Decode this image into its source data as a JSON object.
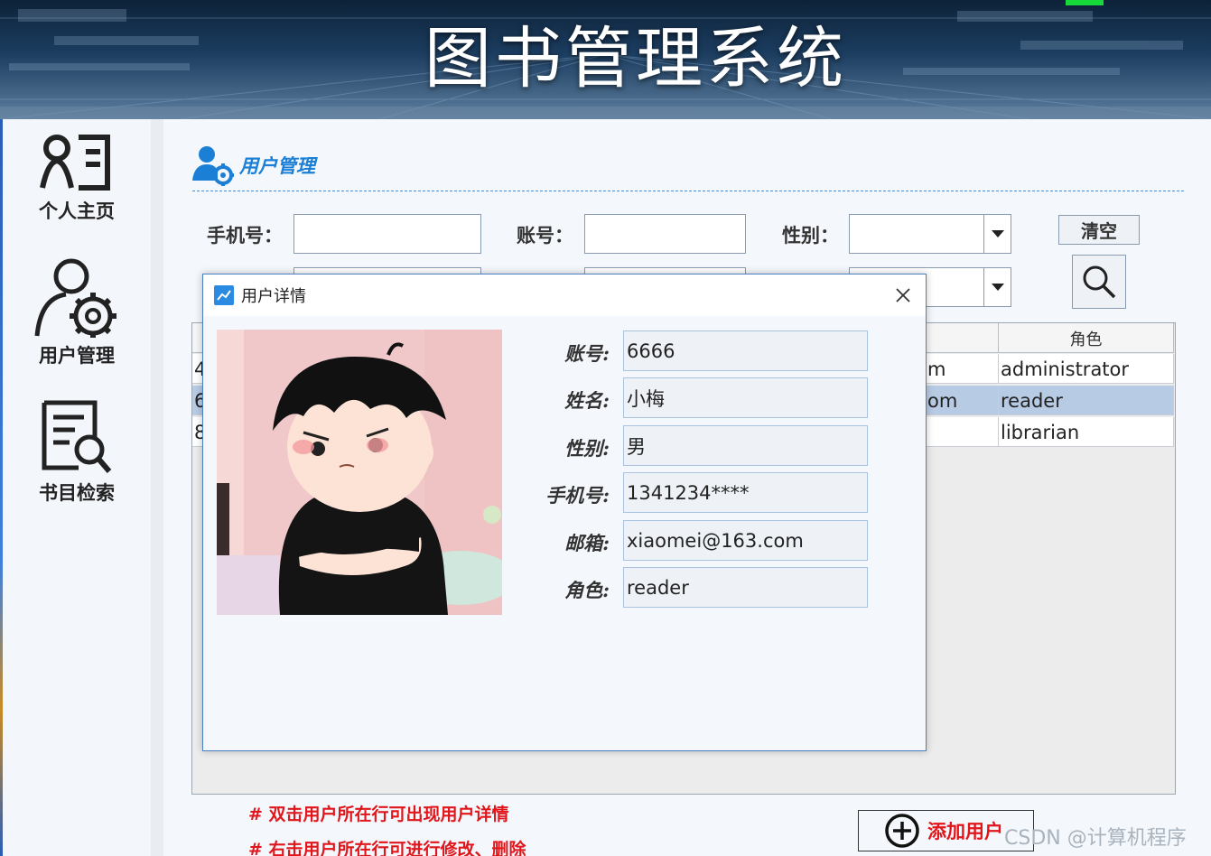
{
  "app": {
    "title": "图书管理系统"
  },
  "sidebar": {
    "items": [
      {
        "label": "个人主页",
        "icon": "profile-card-icon"
      },
      {
        "label": "用户管理",
        "icon": "user-gear-icon"
      },
      {
        "label": "书目检索",
        "icon": "book-search-icon"
      }
    ]
  },
  "page": {
    "section_title": "用户管理",
    "filters": {
      "phone_label": "手机号：",
      "account_label": "账号：",
      "gender_label": "性别：",
      "phone_value": "",
      "account_value": "",
      "gender_value": ""
    },
    "clear_button": "清空",
    "search_icon": "search-icon"
  },
  "table": {
    "role_header": "角色",
    "rows": [
      {
        "id_fragment": "4",
        "email_fragment": "m",
        "role": "administrator",
        "selected": false
      },
      {
        "id_fragment": "6",
        "email_fragment": "om",
        "role": "reader",
        "selected": true
      },
      {
        "id_fragment": "8",
        "email_fragment": "",
        "role": "librarian",
        "selected": false
      }
    ]
  },
  "hints": [
    "# 双击用户所在行可出现用户详情",
    "# 右击用户所在行可进行修改、删除"
  ],
  "add_user_button": "添加用户",
  "dialog": {
    "title": "用户详情",
    "fields": [
      {
        "label": "账号:",
        "value": "6666"
      },
      {
        "label": "姓名:",
        "value": "小梅"
      },
      {
        "label": "性别:",
        "value": "男"
      },
      {
        "label": "手机号:",
        "value": "1341234****"
      },
      {
        "label": "邮箱:",
        "value": "xiaomei@163.com"
      },
      {
        "label": "角色:",
        "value": "reader"
      }
    ]
  },
  "watermark": "CSDN @计算机程序",
  "colors": {
    "accent_blue": "#1b7fd6",
    "hint_red": "#e0161b",
    "selected_row": "#b8cbe4"
  }
}
